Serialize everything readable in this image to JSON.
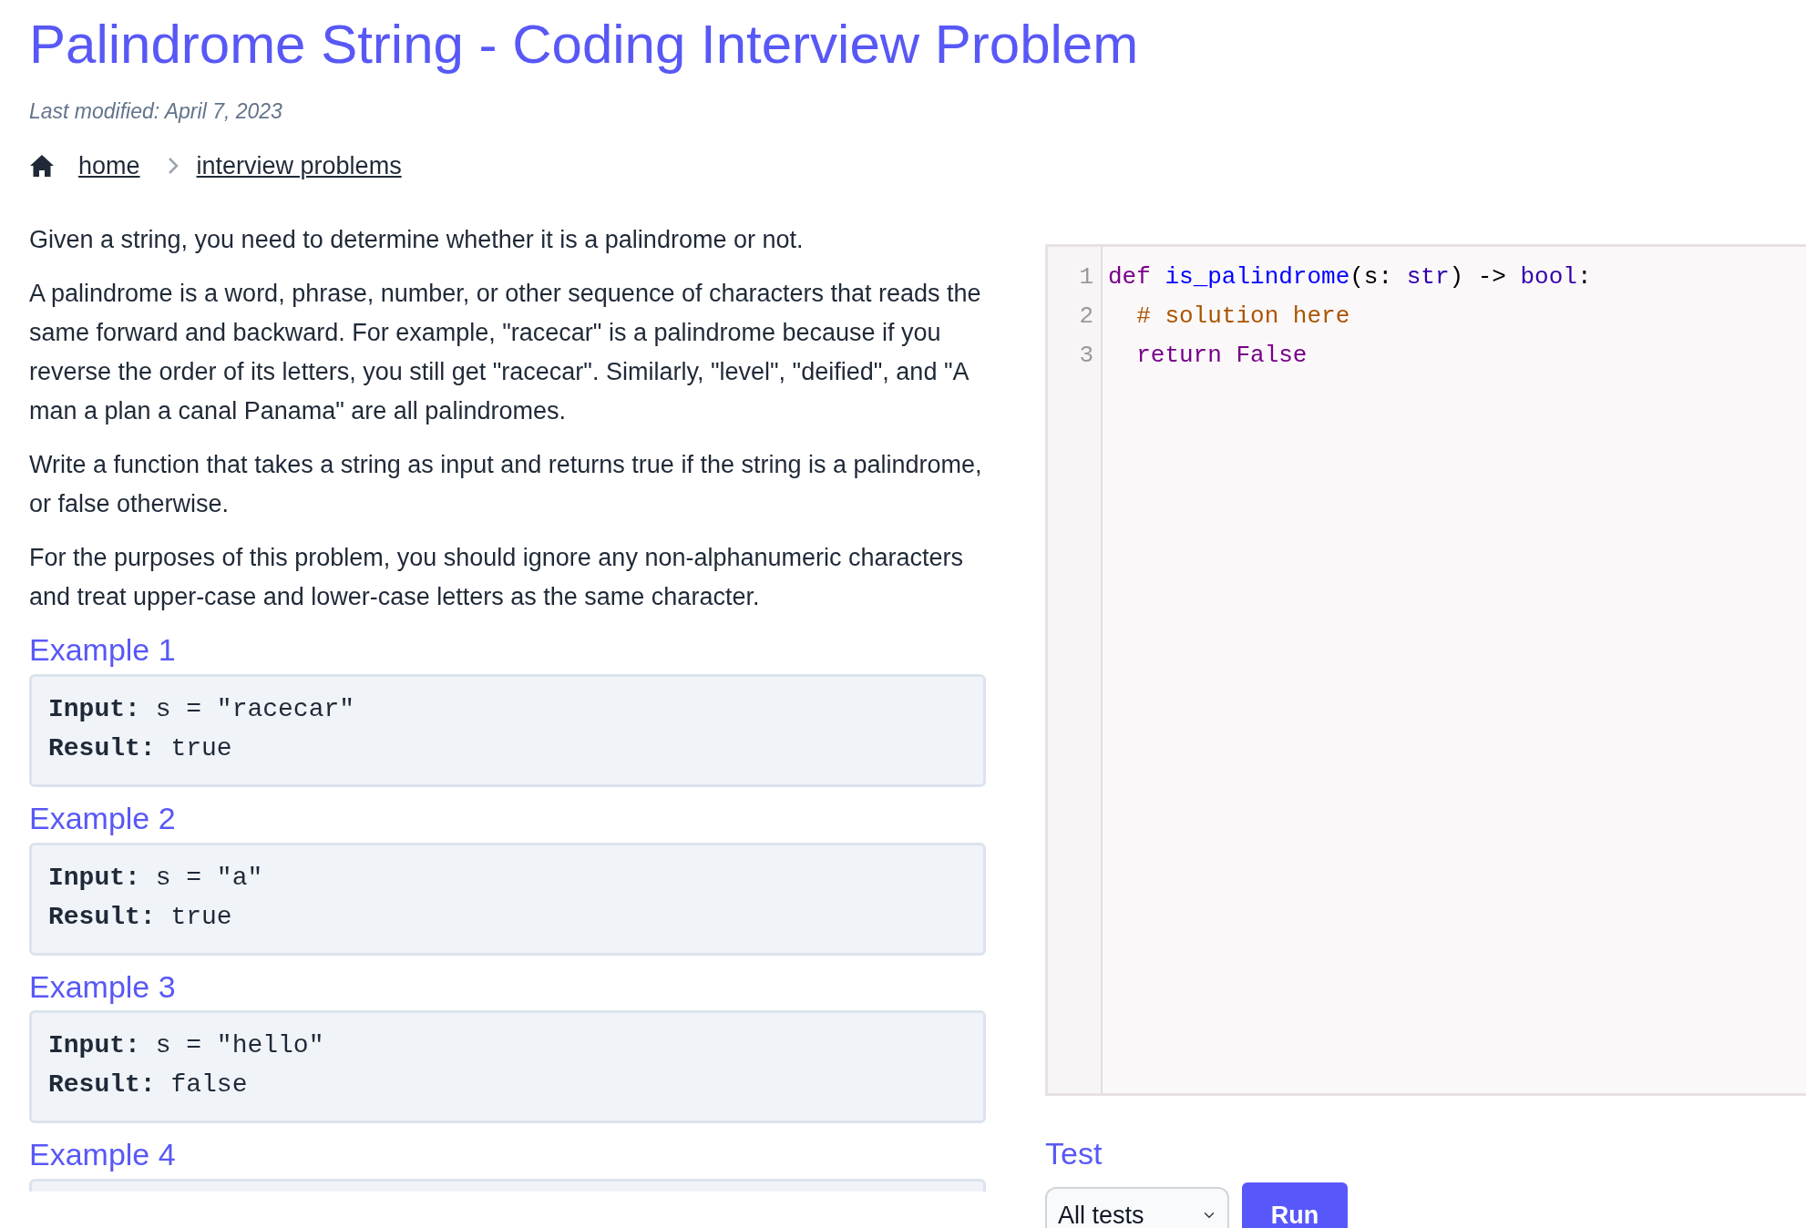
{
  "title": "Palindrome String - Coding Interview Problem",
  "last_modified": "Last modified: April 7, 2023",
  "breadcrumb": [
    {
      "label": "home"
    },
    {
      "label": "interview problems"
    }
  ],
  "paragraphs": [
    "Given a string, you need to determine whether it is a palindrome or not.",
    "A palindrome is a word, phrase, number, or other sequence of characters that reads the same forward and backward. For example, \"racecar\" is a palindrome because if you reverse the order of its letters, you still get \"racecar\". Similarly, \"level\", \"deified\", and \"A man a plan a canal Panama\" are all palindromes.",
    "Write a function that takes a string as input and returns true if the string is a palindrome, or false otherwise.",
    "For the purposes of this problem, you should ignore any non-alphanumeric characters and treat upper-case and lower-case letters as the same character."
  ],
  "examples": [
    {
      "heading": "Example 1",
      "lines": [
        "**Input:** s = \"racecar\"",
        "**Result:** true"
      ]
    },
    {
      "heading": "Example 2",
      "lines": [
        "**Input:** s = \"a\"",
        "**Result:** true"
      ]
    },
    {
      "heading": "Example 3",
      "lines": [
        "**Input:** s = \"hello\"",
        "**Result:** false"
      ]
    },
    {
      "heading": "Example 4"
    }
  ],
  "editor": {
    "lines": [
      {
        "number": "1",
        "tokens": [
          {
            "text": "def ",
            "kind": "keyword"
          },
          {
            "text": "is_palindrome",
            "kind": "def"
          },
          {
            "text": "(s: ",
            "kind": "plain"
          },
          {
            "text": "str",
            "kind": "builtin"
          },
          {
            "text": ") -> ",
            "kind": "plain"
          },
          {
            "text": "bool",
            "kind": "builtin"
          },
          {
            "text": ":",
            "kind": "plain"
          }
        ]
      },
      {
        "number": "2",
        "tokens": [
          {
            "text": "  # solution here",
            "kind": "comment"
          }
        ]
      },
      {
        "number": "3",
        "tokens": [
          {
            "text": "  return ",
            "kind": "keyword"
          },
          {
            "text": "False",
            "kind": "keyword"
          }
        ]
      }
    ]
  },
  "test": {
    "heading": "Test",
    "select_value": "All tests",
    "run_label": "Run"
  }
}
